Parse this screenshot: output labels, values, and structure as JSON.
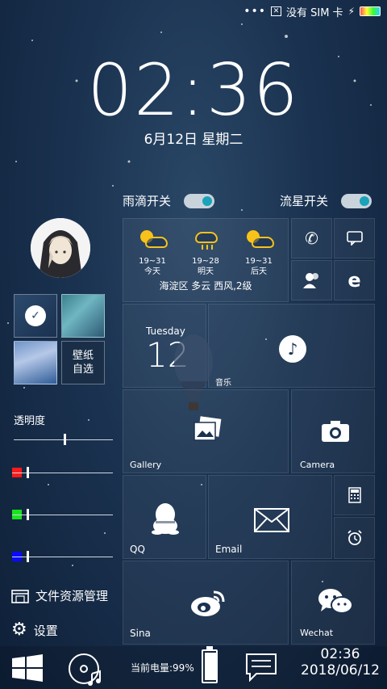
{
  "status_bar": {
    "sim_text": "没有 SIM 卡"
  },
  "lockscreen": {
    "time": "02:36",
    "date": "6月12日 星期二"
  },
  "toggles": [
    {
      "label": "雨滴开关",
      "on": true
    },
    {
      "label": "流星开关",
      "on": true
    }
  ],
  "left": {
    "wallpaper_label": "壁纸\n自选",
    "transparency_label": "透明度",
    "transparency_value": 0.43,
    "color_sliders": [
      {
        "color": "#ff1a1a",
        "value": 0.12
      },
      {
        "color": "#18e51c",
        "value": 0.12
      },
      {
        "color": "#0a0aff",
        "value": 0.12
      }
    ],
    "file_manager_label": "文件资源管理",
    "settings_label": "设置"
  },
  "weather": {
    "days": [
      {
        "range": "19~31",
        "day": "今天",
        "icon": "partly-cloudy-icon"
      },
      {
        "range": "19~28",
        "day": "明天",
        "icon": "rain-cloud-icon"
      },
      {
        "range": "19~31",
        "day": "后天",
        "icon": "partly-cloudy-icon"
      }
    ],
    "location_text": "海淀区  多云 西风,2级"
  },
  "calendar": {
    "weekday": "Tuesday",
    "day_num": "12"
  },
  "tiles": {
    "music_label": "音乐",
    "gallery_label": "Gallery",
    "camera_label": "Camera",
    "qq_label": "QQ",
    "email_label": "Email",
    "sina_label": "Sina",
    "wechat_label": "Wechat"
  },
  "bottom": {
    "battery_text": "当前电量:99%",
    "battery_level": 0.99,
    "time": "02:36",
    "date": "2018/06/12"
  },
  "colors": {
    "accent": "#1aa3b8",
    "weather_yellow": "#f7c21a"
  }
}
